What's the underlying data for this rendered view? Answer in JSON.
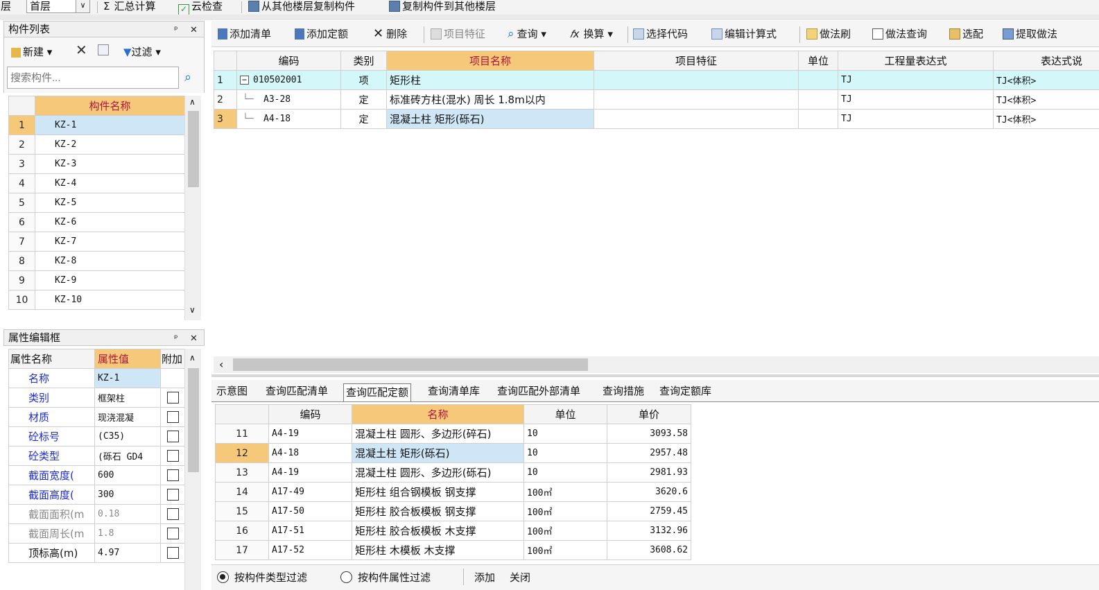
{
  "topbar": {
    "floor_label": "楼层",
    "floor_value": "首层",
    "sum_calc": "汇总计算",
    "cloud_check": "云检查",
    "copy_from_floor": "从其他楼层复制构件",
    "copy_to_floor": "复制构件到其他楼层"
  },
  "component_list": {
    "title": "构件列表",
    "new_label": "新建",
    "filter_label": "过滤",
    "search_placeholder": "搜索构件...",
    "column_header": "构件名称",
    "rows": [
      {
        "num": "1",
        "name": "KZ-1"
      },
      {
        "num": "2",
        "name": "KZ-2"
      },
      {
        "num": "3",
        "name": "KZ-3"
      },
      {
        "num": "4",
        "name": "KZ-4"
      },
      {
        "num": "5",
        "name": "KZ-5"
      },
      {
        "num": "6",
        "name": "KZ-6"
      },
      {
        "num": "7",
        "name": "KZ-7"
      },
      {
        "num": "8",
        "name": "KZ-8"
      },
      {
        "num": "9",
        "name": "KZ-9"
      },
      {
        "num": "10",
        "name": "KZ-10"
      }
    ]
  },
  "property_panel": {
    "title": "属性编辑框",
    "headers": [
      "属性名称",
      "属性值",
      "附加"
    ],
    "rows": [
      {
        "name": "名称",
        "value": "KZ-1"
      },
      {
        "name": "类别",
        "value": "框架柱"
      },
      {
        "name": "材质",
        "value": "现浇混凝"
      },
      {
        "name": "砼标号",
        "value": "(C35)"
      },
      {
        "name": "砼类型",
        "value": "(砾石 GD4"
      },
      {
        "name": "截面宽度(",
        "value": "600"
      },
      {
        "name": "截面高度(",
        "value": "300"
      },
      {
        "name": "截面面积(m",
        "value": "0.18"
      },
      {
        "name": "截面周长(m",
        "value": "1.8"
      },
      {
        "name": "顶标高(m)",
        "value": "4.97"
      }
    ]
  },
  "main_toolbar": {
    "add_list": "添加清单",
    "add_quota": "添加定额",
    "delete": "删除",
    "item_feature": "项目特征",
    "query": "查询",
    "convert": "换算",
    "select_code": "选择代码",
    "edit_formula": "编辑计算式",
    "method_brush": "做法刷",
    "method_query": "做法查询",
    "select_match": "选配",
    "extract_method": "提取做法"
  },
  "main_table": {
    "headers": [
      "编码",
      "类别",
      "项目名称",
      "项目特征",
      "单位",
      "工程量表达式",
      "表达式说"
    ],
    "rows": [
      {
        "num": "1",
        "code": "010502001",
        "type": "项",
        "name": "矩形柱",
        "feature": "",
        "unit": "",
        "expr": "TJ",
        "desc": "TJ<体积>"
      },
      {
        "num": "2",
        "code": "A3-28",
        "type": "定",
        "name": "标准砖方柱(混水) 周长 1.8m以内",
        "feature": "",
        "unit": "",
        "expr": "TJ",
        "desc": "TJ<体积>"
      },
      {
        "num": "3",
        "code": "A4-18",
        "type": "定",
        "name": "混凝土柱 矩形(砾石)",
        "feature": "",
        "unit": "",
        "expr": "TJ",
        "desc": "TJ<体积>"
      }
    ]
  },
  "bottom_tabs": [
    "示意图",
    "查询匹配清单",
    "查询匹配定额",
    "查询清单库",
    "查询匹配外部清单",
    "查询措施",
    "查询定额库"
  ],
  "quota_table": {
    "headers": [
      "编码",
      "名称",
      "单位",
      "单价"
    ],
    "rows": [
      {
        "num": "11",
        "code": "A4-19",
        "name": "混凝土柱 圆形、多边形(碎石)",
        "unit": "10",
        "price": "3093.58"
      },
      {
        "num": "12",
        "code": "A4-18",
        "name": "混凝土柱 矩形(砾石)",
        "unit": "10",
        "price": "2957.48"
      },
      {
        "num": "13",
        "code": "A4-19",
        "name": "混凝土柱 圆形、多边形(砾石)",
        "unit": "10",
        "price": "2981.93"
      },
      {
        "num": "14",
        "code": "A17-49",
        "name": "矩形柱 组合钢模板 钢支撑",
        "unit": "100㎡",
        "price": "3620.6"
      },
      {
        "num": "15",
        "code": "A17-50",
        "name": "矩形柱 胶合板模板 钢支撑",
        "unit": "100㎡",
        "price": "2759.45"
      },
      {
        "num": "16",
        "code": "A17-51",
        "name": "矩形柱 胶合板模板 木支撑",
        "unit": "100㎡",
        "price": "3132.96"
      },
      {
        "num": "17",
        "code": "A17-52",
        "name": "矩形柱 木模板 木支撑",
        "unit": "100㎡",
        "price": "3608.62"
      }
    ]
  },
  "bottom_bar": {
    "filter_type": "按构件类型过滤",
    "filter_attr": "按构件属性过滤",
    "add": "添加",
    "close": "关闭"
  }
}
